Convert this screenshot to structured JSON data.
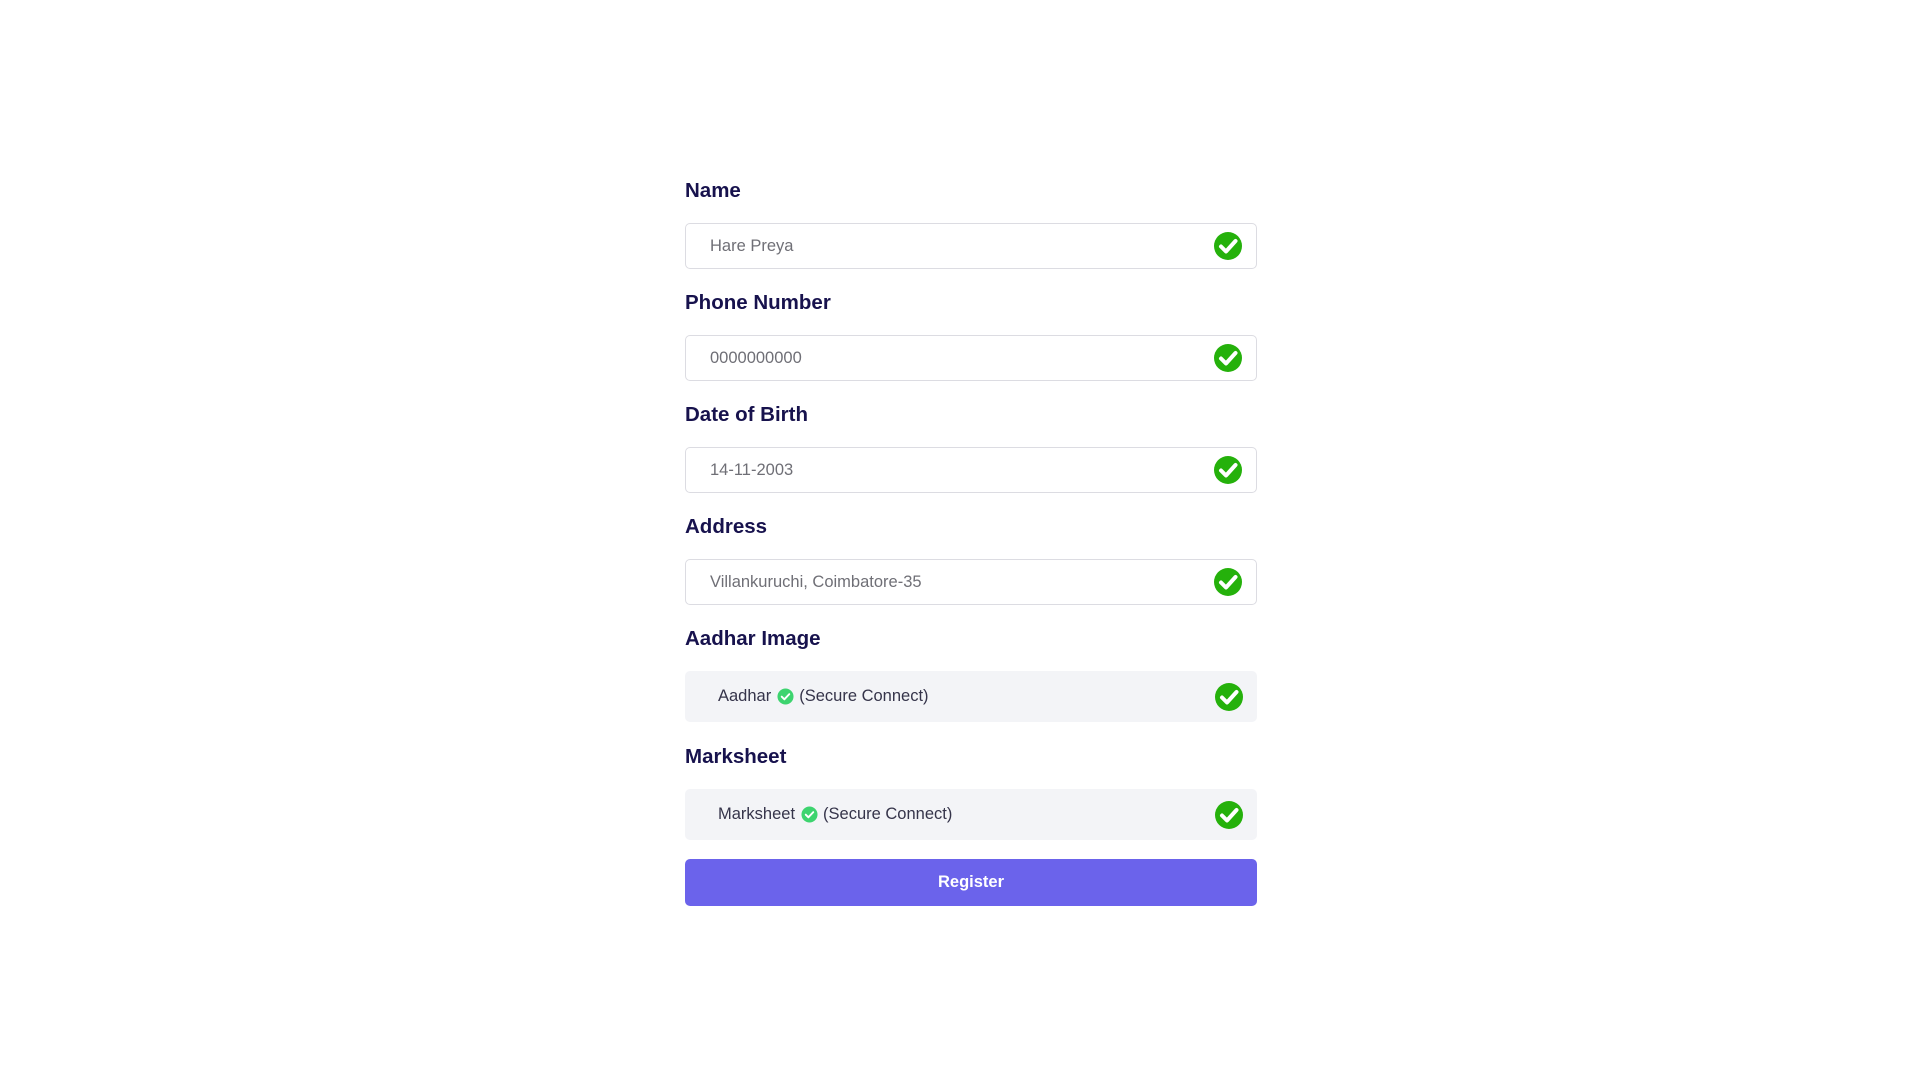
{
  "form": {
    "fields": [
      {
        "label": "Name",
        "value": "Hare Preya"
      },
      {
        "label": "Phone Number",
        "value": "0000000000"
      },
      {
        "label": "Date of Birth",
        "value": "14-11-2003"
      },
      {
        "label": "Address",
        "value": "Villankuruchi, Coimbatore-35"
      }
    ],
    "uploads": [
      {
        "label": "Aadhar Image",
        "file_name": "Aadhar",
        "status_text": "(Secure Connect)"
      },
      {
        "label": "Marksheet",
        "file_name": "Marksheet",
        "status_text": "(Secure Connect)"
      }
    ],
    "submit_label": "Register"
  },
  "icons": {
    "field_valid": "check-circle-icon",
    "upload_verified": "check-circle-icon"
  },
  "colors": {
    "label": "#17124d",
    "valid_check": "#25b10b",
    "inline_check": "#3dd46f",
    "button": "#6b63eb",
    "upload_bg": "#f3f4f7"
  }
}
